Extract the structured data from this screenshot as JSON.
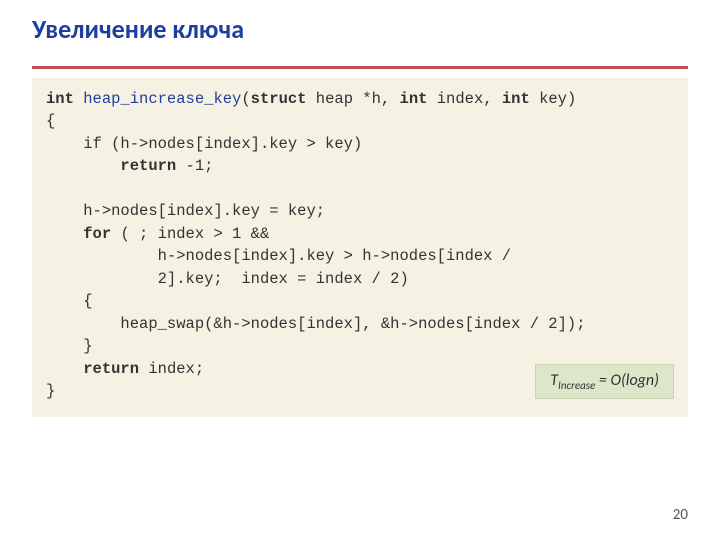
{
  "title": "Увеличение ключа",
  "code": {
    "lines": [
      {
        "indent": 0,
        "tokens": [
          {
            "t": "int ",
            "c": "kw"
          },
          {
            "t": "heap_increase_key",
            "c": "fn"
          },
          {
            "t": "(",
            "c": ""
          },
          {
            "t": "struct ",
            "c": "kw"
          },
          {
            "t": "heap *h, ",
            "c": ""
          },
          {
            "t": "int ",
            "c": "kw"
          },
          {
            "t": "index, ",
            "c": ""
          },
          {
            "t": "int ",
            "c": "kw"
          },
          {
            "t": "key)",
            "c": ""
          }
        ]
      },
      {
        "indent": 0,
        "tokens": [
          {
            "t": "{",
            "c": ""
          }
        ]
      },
      {
        "indent": 1,
        "tokens": [
          {
            "t": "if (h->nodes[index].key > key)",
            "c": ""
          }
        ]
      },
      {
        "indent": 2,
        "tokens": [
          {
            "t": "return ",
            "c": "kw"
          },
          {
            "t": "-1;",
            "c": ""
          }
        ]
      },
      {
        "indent": 0,
        "tokens": [
          {
            "t": "",
            "c": ""
          }
        ]
      },
      {
        "indent": 1,
        "tokens": [
          {
            "t": "h->nodes[index].key = key;",
            "c": ""
          }
        ]
      },
      {
        "indent": 1,
        "tokens": [
          {
            "t": "for ",
            "c": "kw"
          },
          {
            "t": "( ; index > 1 &&",
            "c": ""
          }
        ]
      },
      {
        "indent": 3,
        "tokens": [
          {
            "t": "h->nodes[index].key > h->nodes[index /",
            "c": ""
          }
        ]
      },
      {
        "indent": 3,
        "tokens": [
          {
            "t": "2].key;  index = index / 2)",
            "c": ""
          }
        ]
      },
      {
        "indent": 1,
        "tokens": [
          {
            "t": "{",
            "c": ""
          }
        ]
      },
      {
        "indent": 2,
        "tokens": [
          {
            "t": "heap_swap(&h->nodes[index], &h->nodes[index / 2]);",
            "c": ""
          }
        ]
      },
      {
        "indent": 1,
        "tokens": [
          {
            "t": "}",
            "c": ""
          }
        ]
      },
      {
        "indent": 1,
        "tokens": [
          {
            "t": "return ",
            "c": "kw"
          },
          {
            "t": "index;",
            "c": ""
          }
        ]
      },
      {
        "indent": 0,
        "tokens": [
          {
            "t": "}",
            "c": ""
          }
        ]
      }
    ]
  },
  "complexity": {
    "symbol": "T",
    "subscript": "Increase",
    "equals": " = ",
    "big_o": "O",
    "open": "(log",
    "var": "n",
    "close": ")"
  },
  "page_number": "20",
  "chart_data": null
}
